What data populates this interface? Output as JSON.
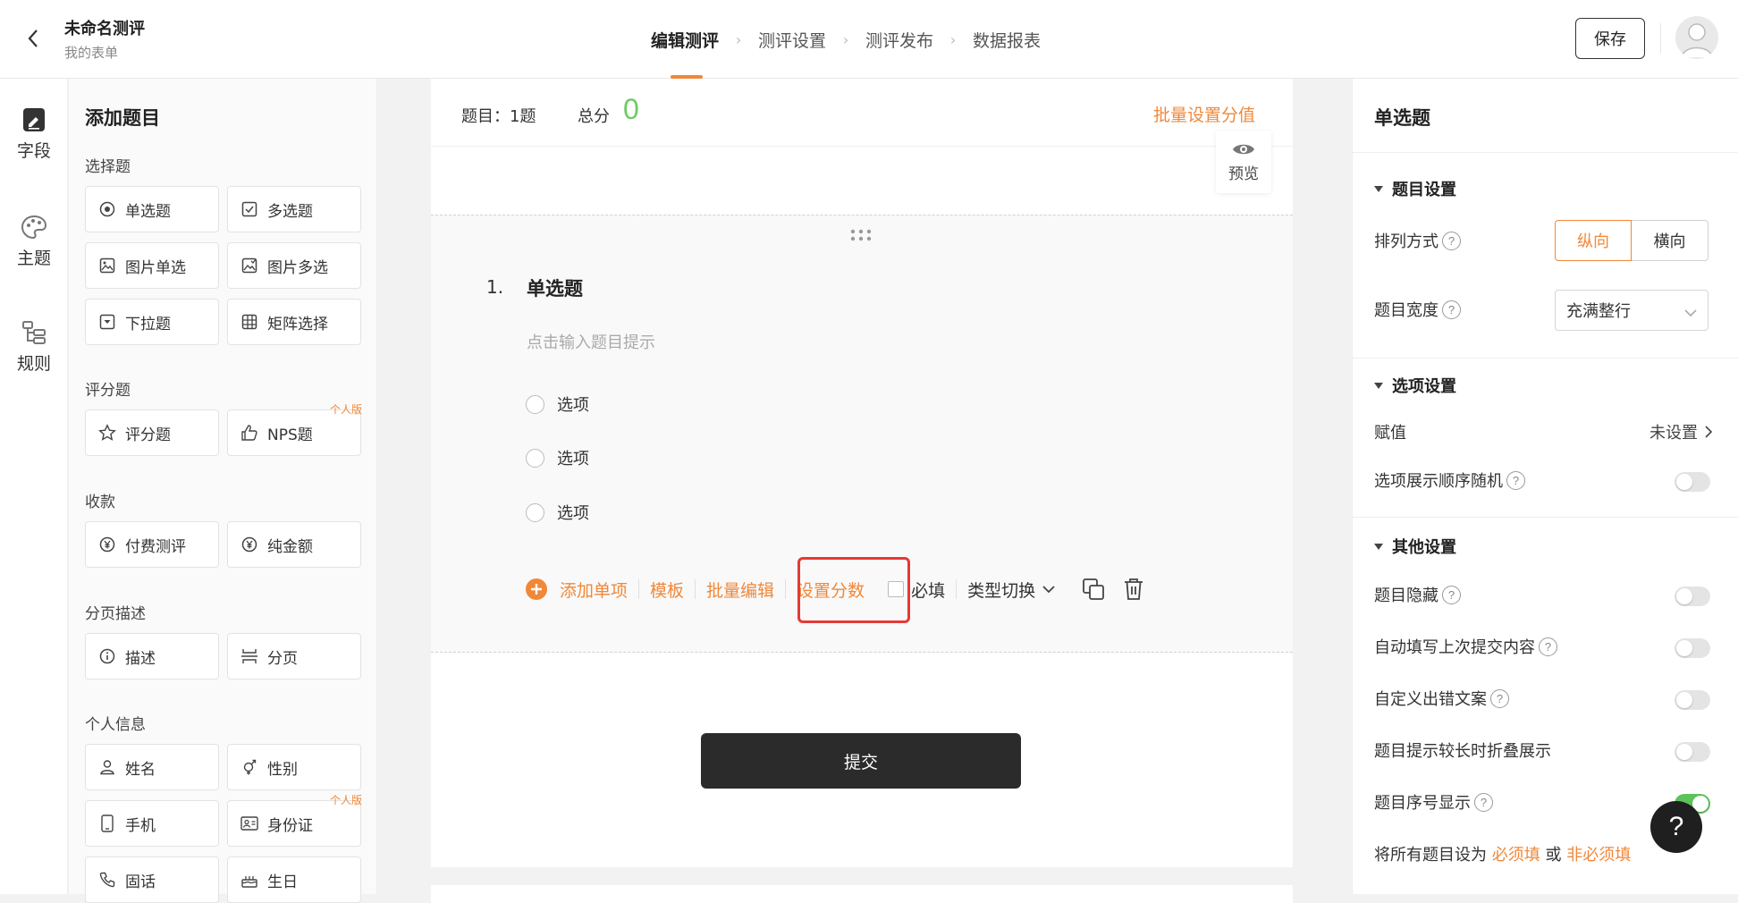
{
  "header": {
    "title": "未命名测评",
    "subtitle": "我的表单",
    "steps": [
      "编辑测评",
      "测评设置",
      "测评发布",
      "数据报表"
    ],
    "save_label": "保存"
  },
  "nav": {
    "items": [
      "字段",
      "主题",
      "规则"
    ]
  },
  "library": {
    "title": "添加题目",
    "groups": {
      "choice": "选择题",
      "rating": "评分题",
      "payment": "收款",
      "page": "分页描述",
      "personal": "个人信息"
    },
    "tiles": {
      "single": "单选题",
      "multi": "多选题",
      "img_single": "图片单选",
      "img_multi": "图片多选",
      "dropdown": "下拉题",
      "matrix": "矩阵选择",
      "rating": "评分题",
      "nps": "NPS题",
      "paid": "付费测评",
      "amount": "纯金额",
      "desc": "描述",
      "pagebreak": "分页",
      "name": "姓名",
      "gender": "性别",
      "phone": "手机",
      "idcard": "身份证",
      "tel": "固话",
      "birthday": "生日"
    },
    "badge": "个人版"
  },
  "canvas": {
    "question_count": "题目：1题",
    "total_label": "总分",
    "total_value": "0",
    "batch_score": "批量设置分值",
    "preview": "预览",
    "question": {
      "number": "1.",
      "title": "单选题",
      "hint": "点击输入题目提示",
      "options": [
        "选项",
        "选项",
        "选项"
      ]
    },
    "actions": {
      "add_option": "添加单项",
      "template": "模板",
      "batch_edit": "批量编辑",
      "set_score": "设置分数",
      "required": "必填",
      "switch_type": "类型切换"
    },
    "submit": "提交"
  },
  "panel": {
    "title": "单选题",
    "sections": {
      "question": "题目设置",
      "options": "选项设置",
      "other": "其他设置"
    },
    "layout_label": "排列方式",
    "layout_options": [
      "纵向",
      "横向"
    ],
    "width_label": "题目宽度",
    "width_value": "充满整行",
    "assign_label": "赋值",
    "assign_value": "未设置",
    "random_label": "选项展示顺序随机",
    "hide_label": "题目隐藏",
    "autofill_label": "自动填写上次提交内容",
    "custom_error_label": "自定义出错文案",
    "fold_label": "题目提示较长时折叠展示",
    "seq_label": "题目序号显示",
    "bottom_prefix": "将所有题目设为",
    "bottom_required": "必须填",
    "bottom_or": "或",
    "bottom_optional": "非必须填"
  },
  "help": "?"
}
